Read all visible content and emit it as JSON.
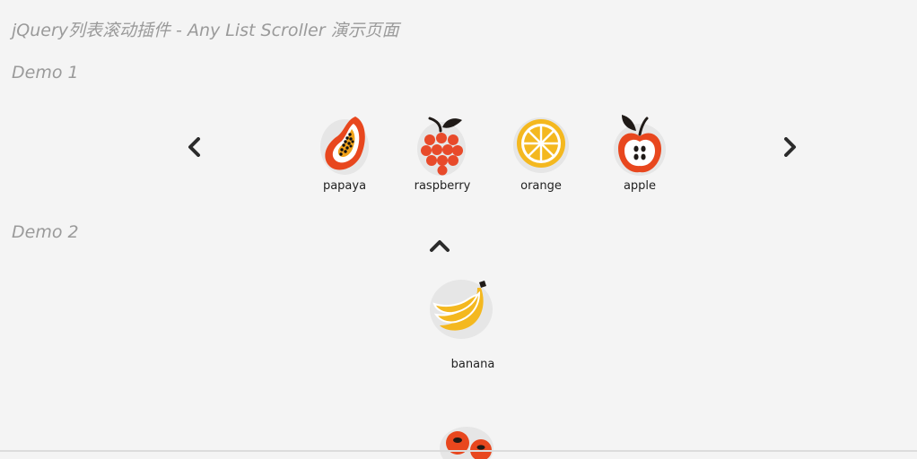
{
  "page": {
    "title": "jQuery列表滚动插件 - Any List Scroller 演示页面"
  },
  "demo1": {
    "title": "Demo 1",
    "items": [
      {
        "label": "papaya",
        "icon": "papaya-icon"
      },
      {
        "label": "raspberry",
        "icon": "raspberry-icon"
      },
      {
        "label": "orange",
        "icon": "orange-icon"
      },
      {
        "label": "apple",
        "icon": "apple-icon"
      }
    ],
    "prev_icon": "chevron-left-icon",
    "next_icon": "chevron-right-icon"
  },
  "demo2": {
    "title": "Demo 2",
    "items": [
      {
        "label": "banana",
        "icon": "banana-icon"
      },
      {
        "label": "",
        "icon": "cherry-icon"
      }
    ],
    "up_icon": "chevron-up-icon"
  },
  "colors": {
    "heading": "#9a9a9a",
    "arrow": "#2b2b2b",
    "text": "#222222",
    "background": "#f4f4f4"
  }
}
